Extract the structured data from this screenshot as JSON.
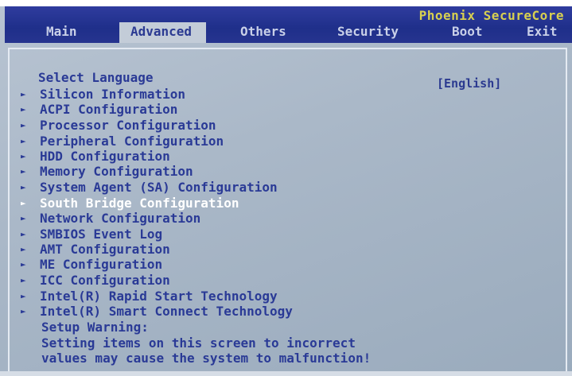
{
  "vendor": "Phoenix SecureCore",
  "tabs": [
    "Main",
    "Advanced",
    "Others",
    "Security",
    "Boot",
    "Exit"
  ],
  "active_tab": "Advanced",
  "select_language": {
    "label": "Select Language",
    "value": "[English]"
  },
  "menu_items": [
    "Silicon Information",
    "ACPI Configuration",
    "Processor Configuration",
    "Peripheral Configuration",
    "HDD Configuration",
    "Memory Configuration",
    "System Agent (SA) Configuration",
    "South Bridge Configuration",
    "Network Configuration",
    "SMBIOS Event Log",
    "AMT Configuration",
    "ME Configuration",
    "ICC Configuration",
    "Intel(R) Rapid Start Technology",
    "Intel(R) Smart Connect Technology"
  ],
  "selected_item": "South Bridge Configuration",
  "arrow_glyph": "►",
  "warning": {
    "title": "Setup Warning:",
    "line1": "Setting items on this screen to incorrect",
    "line2": "values may cause the system to malfunction!"
  },
  "colors": {
    "menubar": "#1f2f8a",
    "text": "#2a3a96",
    "vendor": "#d8d050",
    "selected": "#ffffff",
    "panel": "#aab8c8"
  }
}
